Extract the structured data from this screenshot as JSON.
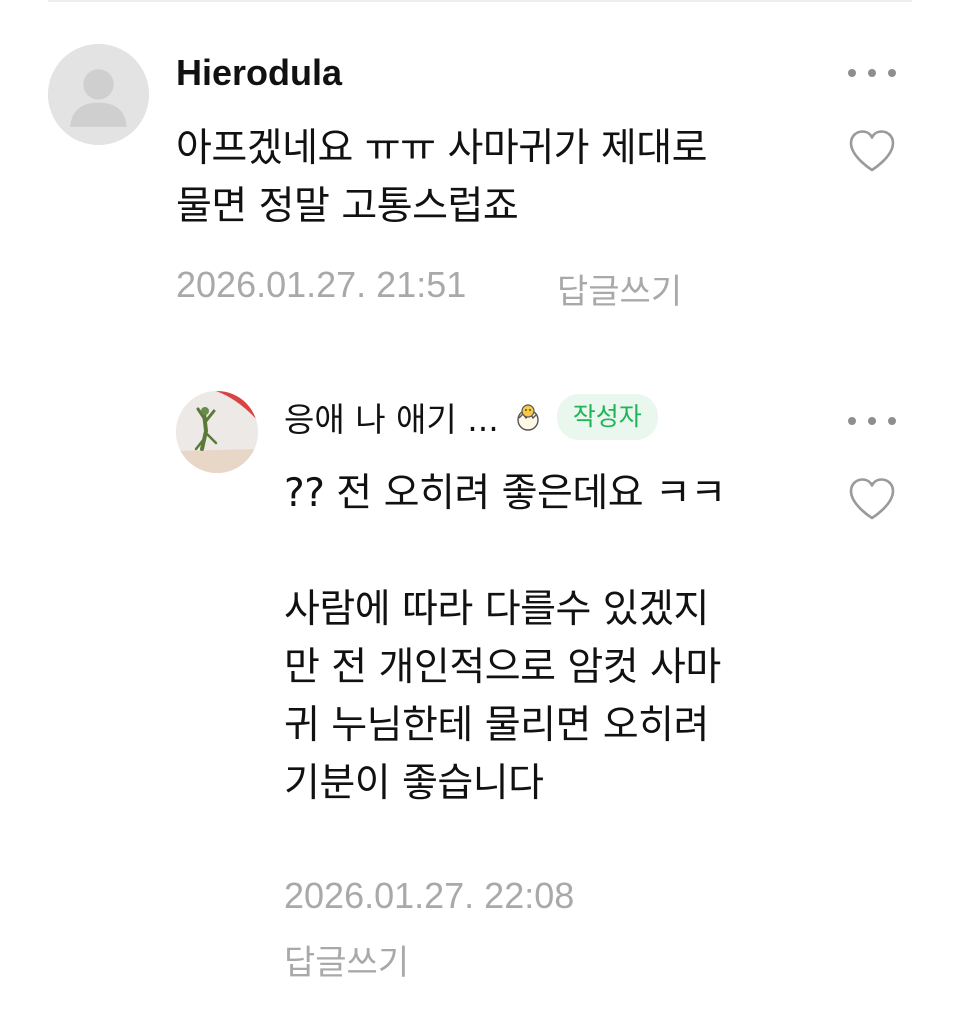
{
  "comments": [
    {
      "nickname": "Hierodula",
      "text": "아프겠네요 ㅠㅠ 사마귀가 제대로\n물면 정말 고통스럽죠",
      "date": "2026.01.27. 21:51",
      "reply_label": "답글쓰기",
      "avatar_icon": "default-profile-icon"
    },
    {
      "nickname": "응애 나 애기 ...",
      "author_badge": "작성자",
      "text": "?? 전 오히려 좋은데요 ㅋㅋ\n\n사람에 따라 다를수 있겠지\n만 전 개인적으로 암컷 사마\n귀 누님한테 물리면 오히려\n기분이 좋습니다",
      "date": "2026.01.27. 22:08",
      "reply_label": "답글쓰기",
      "avatar_icon": "mantis-photo-avatar",
      "badge_icon": "hatching-egg-icon"
    }
  ],
  "colors": {
    "badge_bg": "#eaf7ee",
    "badge_text": "#1fb457",
    "meta_text": "#a9a9a9"
  }
}
